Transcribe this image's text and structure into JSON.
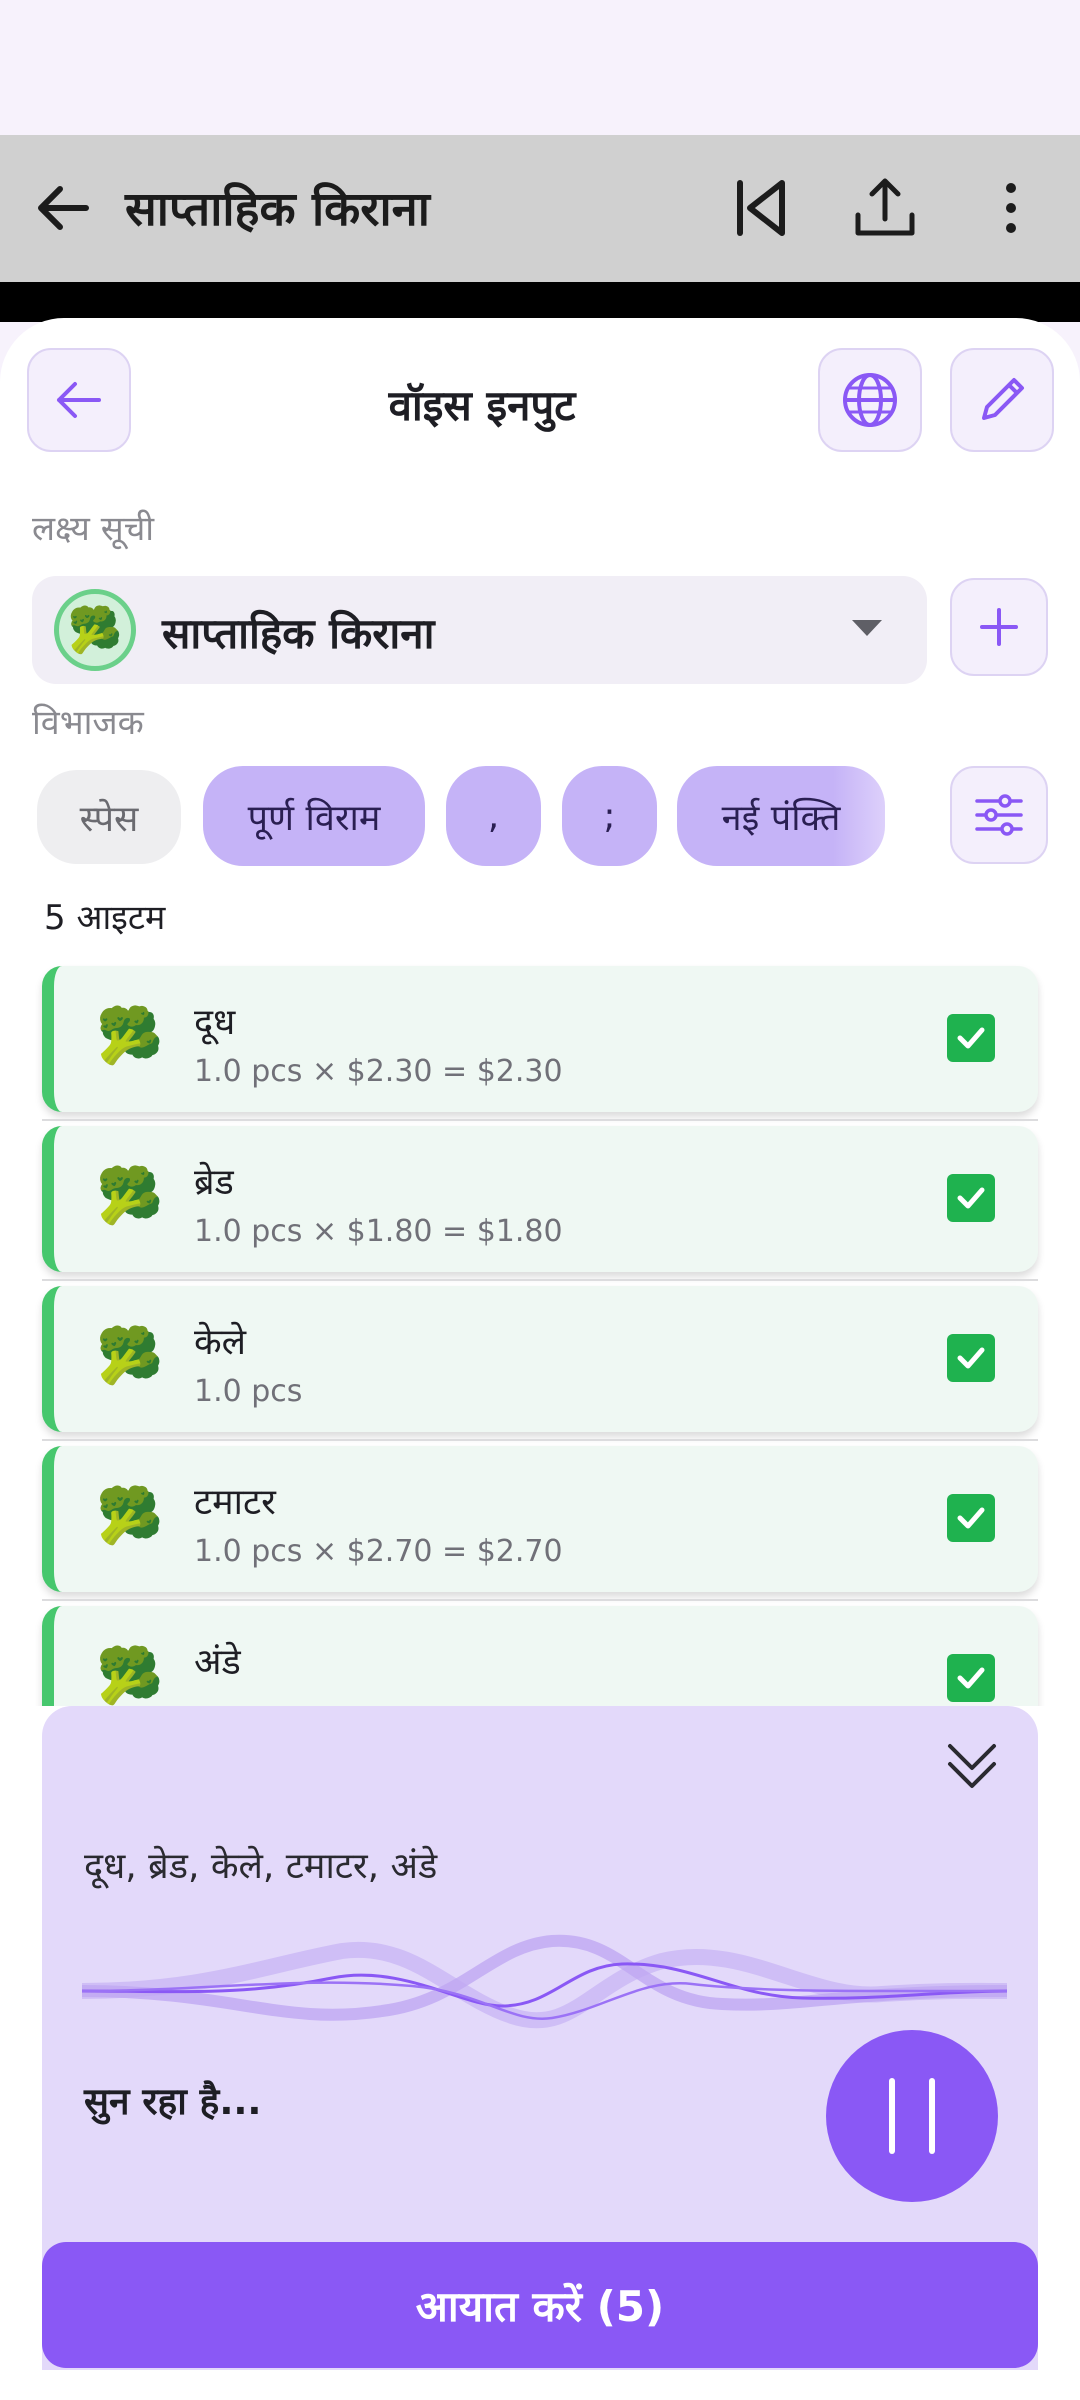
{
  "app_bar": {
    "title": "साप्ताहिक किराना",
    "icons": [
      "back-arrow-icon",
      "skip-previous-icon",
      "share-icon",
      "more-vertical-icon"
    ]
  },
  "sheet": {
    "title": "वॉइस इनपुट",
    "icons": [
      "back-arrow-icon",
      "globe-icon",
      "pencil-icon"
    ]
  },
  "target_list": {
    "label": "लक्ष्य सूची",
    "selected": "साप्ताहिक किराना",
    "avatar_icon": "broccoli-icon"
  },
  "separator": {
    "label": "विभाजक",
    "chips": [
      {
        "label": "स्पेस",
        "selected": false
      },
      {
        "label": "पूर्ण विराम",
        "selected": true
      },
      {
        "label": ",",
        "selected": true
      },
      {
        "label": ";",
        "selected": true
      },
      {
        "label": "नई पंक्ति",
        "selected": true
      }
    ]
  },
  "items_count": "5 आइटम",
  "items": [
    {
      "name": "दूध",
      "detail": "1.0 pcs × $2.30 = $2.30",
      "checked": true,
      "icon": "broccoli-icon"
    },
    {
      "name": "ब्रेड",
      "detail": "1.0 pcs × $1.80 = $1.80",
      "checked": true,
      "icon": "broccoli-icon"
    },
    {
      "name": "केले",
      "detail": "1.0 pcs",
      "checked": true,
      "icon": "broccoli-icon"
    },
    {
      "name": "टमाटर",
      "detail": "1.0 pcs × $2.70 = $2.70",
      "checked": true,
      "icon": "broccoli-icon"
    },
    {
      "name": "अंडे",
      "detail": "",
      "checked": true,
      "icon": "broccoli-icon"
    }
  ],
  "voice": {
    "transcript": "दूध, ब्रेड, केले, टमाटर, अंडे",
    "status": "सुन रहा है...",
    "icons": [
      "collapse-chevrons-icon",
      "pause-icon"
    ]
  },
  "import_button": "आयात करें (5)",
  "colors": {
    "accent": "#8a58f5",
    "chip_selected": "#c5b3f7",
    "item_bg": "#eff8f3",
    "item_border": "#46c76d",
    "check": "#1fb24f",
    "panel": "#e3d9fa"
  }
}
